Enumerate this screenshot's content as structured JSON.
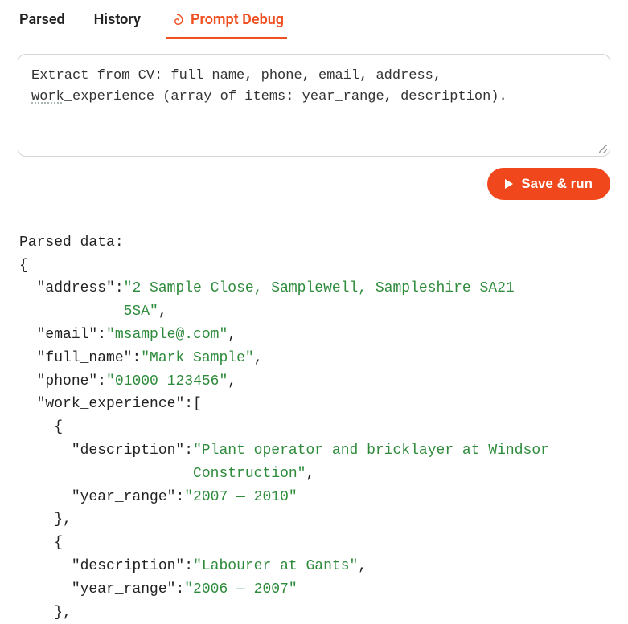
{
  "tabs": {
    "parsed": "Parsed",
    "history": "History",
    "prompt_debug": "Prompt Debug",
    "active": "prompt_debug"
  },
  "prompt": {
    "line1_pre": "Extract from CV: full_name, phone, email, address,",
    "line2_underlined": "work",
    "line2_rest": "_experience (array of items: year_range, description)."
  },
  "actions": {
    "save_run": "Save & run"
  },
  "output": {
    "header": "Parsed data:",
    "open_brace": "{",
    "close_brace": "}",
    "fields": {
      "address_key": "\"address\"",
      "address_val": "\"2 Sample Close, Samplewell, Sampleshire SA21",
      "address_val_cont": "5SA\"",
      "email_key": "\"email\"",
      "email_val": "\"msample@.com\"",
      "full_name_key": "\"full_name\"",
      "full_name_val": "\"Mark Sample\"",
      "phone_key": "\"phone\"",
      "phone_val": "\"01000 123456\"",
      "work_exp_key": "\"work_experience\"",
      "we1_desc_key": "\"description\"",
      "we1_desc_val": "\"Plant operator and bricklayer at Windsor",
      "we1_desc_val_cont": "Construction\"",
      "we1_year_key": "\"year_range\"",
      "we1_year_val": "\"2007 — 2010\"",
      "we2_desc_key": "\"description\"",
      "we2_desc_val": "\"Labourer at Gants\"",
      "we2_year_key": "\"year_range\"",
      "we2_year_val": "\"2006 — 2007\""
    }
  },
  "colors": {
    "accent": "#f05123",
    "string": "#2e8b3c"
  }
}
